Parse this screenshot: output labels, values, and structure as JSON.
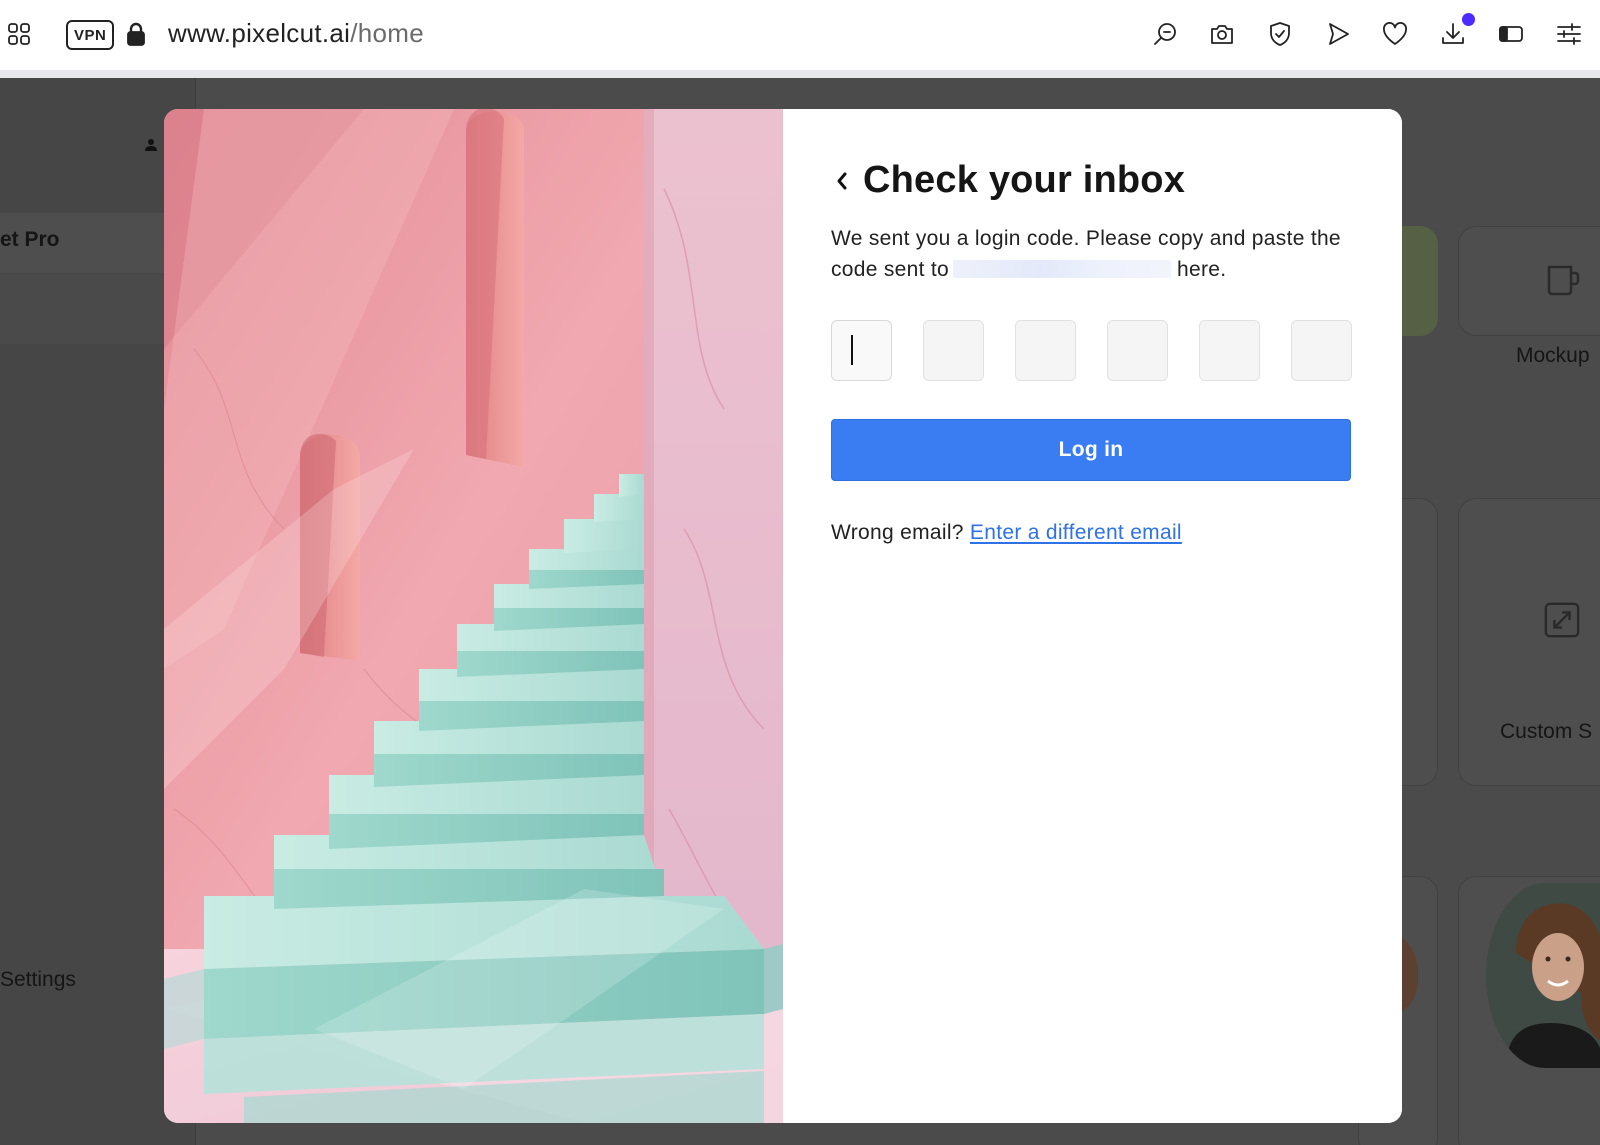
{
  "browser": {
    "vpn_label": "VPN",
    "url_host": "www.pixelcut.ai",
    "url_path": "/home",
    "icons": [
      "tabs-grid-icon",
      "lock-icon",
      "search-icon",
      "camera-icon",
      "shield-icon",
      "send-icon",
      "heart-icon",
      "download-icon",
      "sidebar-icon",
      "settings-sliders-icon"
    ]
  },
  "background": {
    "sidebar_pro_label": "et Pro",
    "sidebar_settings_label": "Settings",
    "card_mockup_label": "Mockup",
    "card_custom_label": "Custom S"
  },
  "modal": {
    "title": "Check your inbox",
    "subtitle_before": "We sent you a login code. Please copy and paste the code sent to",
    "subtitle_after": "here.",
    "code_length": 6,
    "login_label": "Log in",
    "wrong_email_text": "Wrong email?",
    "wrong_email_link": "Enter a different email"
  },
  "colors": {
    "primary_button": "#3a7df2",
    "link": "#2f72e6",
    "overlay": "#4b4b4b"
  }
}
